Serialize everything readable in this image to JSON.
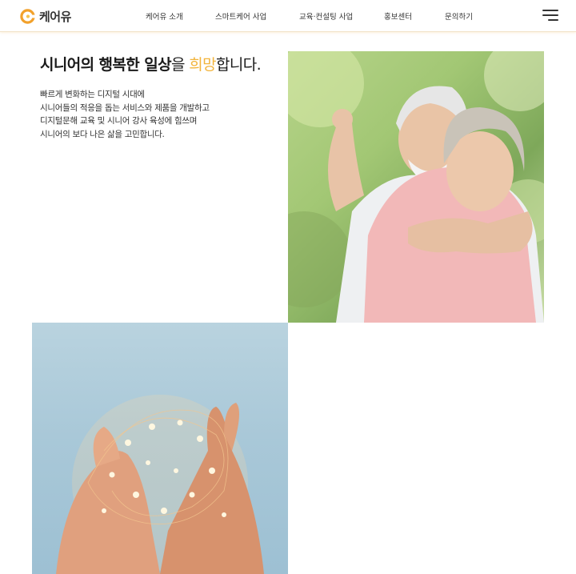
{
  "header": {
    "logo_text": "케어유",
    "nav": [
      "케어유 소개",
      "스마트케어 사업",
      "교육·컨설팅 사업",
      "홍보센터",
      "문의하기"
    ],
    "menu_icon": "hamburger-menu-icon"
  },
  "main": {
    "headline_part1": "시니어의 행복한 일상",
    "headline_part2": "을 ",
    "headline_accent": "희망",
    "headline_part3": "합니다.",
    "body_lines": [
      "빠르게 변화하는 디지털 시대에",
      "시니어들의 적응을 돕는 서비스와 제품을 개발하고",
      "디지털문해 교육 및 시니어 강사 육성에 힘쓰며",
      "시니어의 보다 나은 삶을 고민합니다."
    ]
  },
  "colors": {
    "accent": "#f2b43c",
    "text": "#1a1a1a",
    "header_border": "#f2e3c8"
  }
}
